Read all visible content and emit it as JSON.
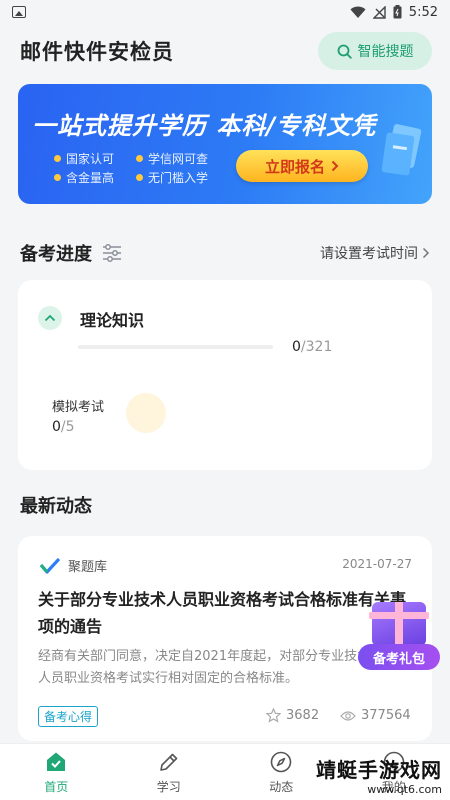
{
  "status_bar": {
    "time": "5:52"
  },
  "header": {
    "title": "邮件快件安检员",
    "search_label": "智能搜题"
  },
  "banner": {
    "headline": "一站式提升学历 本科/专科文凭",
    "features": [
      "国家认可",
      "学信网可查",
      "含金量高",
      "无门槛入学"
    ],
    "cta_label": "立即报名"
  },
  "progress_section": {
    "title": "备考进度",
    "set_time_label": "请设置考试时间",
    "theory": {
      "title": "理论知识",
      "done": "0",
      "total": "/321",
      "progress_fraction": 0
    },
    "mock": {
      "label": "模拟考试",
      "done": "0",
      "total": "/5"
    }
  },
  "news_section": {
    "title": "最新动态",
    "item": {
      "source": "聚题库",
      "date": "2021-07-27",
      "title": "关于部分专业技术人员职业资格考试合格标准有关事项的通告",
      "excerpt": "经商有关部门同意，决定自2021年度起，对部分专业技术人员职业资格考试实行相对固定的合格标准。",
      "tag": "备考心得",
      "favorites": "3682",
      "views": "377564"
    }
  },
  "gift": {
    "label": "备考礼包"
  },
  "tabbar": {
    "tabs": [
      {
        "label": "首页"
      },
      {
        "label": "学习"
      },
      {
        "label": "动态"
      },
      {
        "label": "我的"
      }
    ]
  },
  "watermark": {
    "main": "靖蜓手游戏网",
    "url": "www.qt6.com"
  },
  "colors": {
    "accent": "#1fa776",
    "banner": "#2d7bf5",
    "cta": "#ffc93c",
    "tag": "#1aa5c9",
    "gift": "#7b4ff0"
  }
}
